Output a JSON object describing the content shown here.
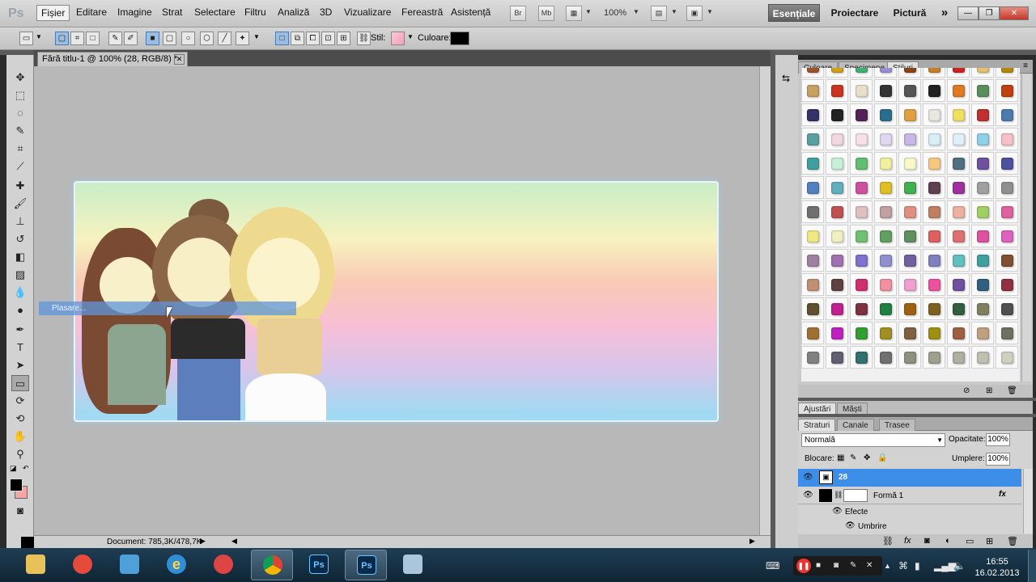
{
  "app": {
    "logo": "Ps"
  },
  "menu": [
    "Fișier",
    "Editare",
    "Imagine",
    "Strat",
    "Selectare",
    "Filtru",
    "Analiză",
    "3D",
    "Vizualizare",
    "Fereastră",
    "Asistență"
  ],
  "menubar_controls": {
    "br": "Br",
    "mb": "Mb",
    "zoom": "100%"
  },
  "workspaces": [
    "Esențiale",
    "Proiectare",
    "Pictură"
  ],
  "workspace_more": "»",
  "window_controls": [
    "—",
    "❐",
    "✕"
  ],
  "options": {
    "style_label": "Stil:",
    "color_label": "Culoare:",
    "color_value": "#000000"
  },
  "document": {
    "tab_title": "Fără titlu-1 @ 100% (28, RGB/8) *",
    "close": "✕",
    "status": "Document: 785,3K/478,7K"
  },
  "canvas": {
    "placement_label": "Plasare..."
  },
  "panel_styles": {
    "tabs": [
      "Culoare",
      "Specimene",
      "Stiluri"
    ],
    "active": "Stiluri"
  },
  "panel_adjust": {
    "tabs": [
      "Ajustări",
      "Măști"
    ]
  },
  "panel_layers": {
    "tabs": [
      "Straturi",
      "Canale",
      "Trasee"
    ],
    "blend_mode": "Normală",
    "opacity_label": "Opacitate:",
    "opacity_value": "100%",
    "lock_label": "Blocare:",
    "fill_label": "Umplere:",
    "fill_value": "100%",
    "layers": [
      {
        "name": "28",
        "selected": true
      },
      {
        "name": "Formă 1",
        "fx": "fx"
      },
      {
        "name": "Efecte"
      },
      {
        "name": "Umbrire"
      }
    ]
  },
  "taskbar": {
    "time": "16:55",
    "date": "16.02.2013",
    "apps": [
      "Ps",
      "Ps"
    ]
  },
  "colors": {
    "foreground": "#000000",
    "background": "#f4a6a6",
    "selected_layer": "#3d8ee8"
  }
}
